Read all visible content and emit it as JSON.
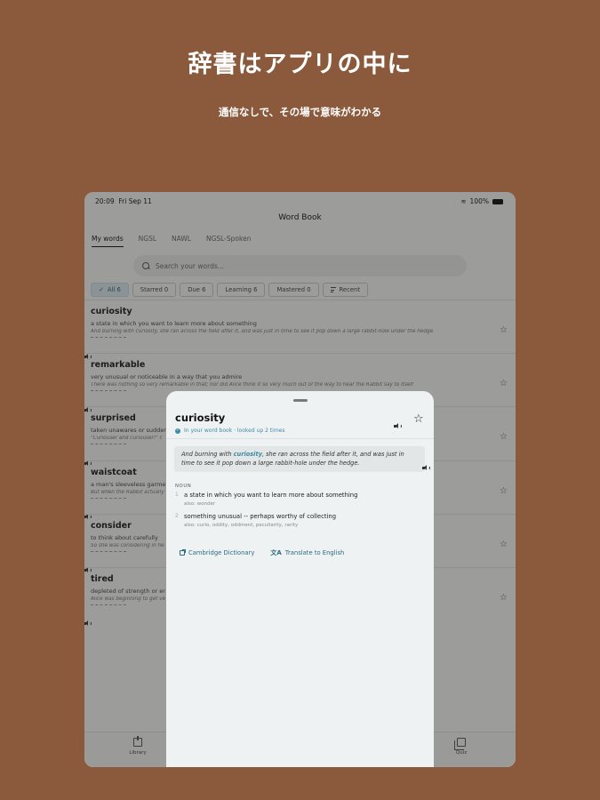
{
  "hero": {
    "title": "辞書はアプリの中に",
    "subtitle": "通信なしで、その場で意味がわかる"
  },
  "status_bar": {
    "time": "20:09",
    "date": "Fri Sep 11",
    "battery": "100%"
  },
  "nav": {
    "title": "Word Book"
  },
  "tabs": [
    "My words",
    "NGSL",
    "NAWL",
    "NGSL-Spoken"
  ],
  "search": {
    "placeholder": "Search your words..."
  },
  "filters": [
    "All 6",
    "Starred 0",
    "Due 6",
    "Learning 6",
    "Mastered 0",
    "Recent"
  ],
  "words": [
    {
      "word": "curiosity",
      "def": "a state in which you want to learn more about something",
      "example": "And burning with curiosity, she ran across the field after it, and was just in time to see it pop down a large rabbit-hole under the hedge."
    },
    {
      "word": "remarkable",
      "def": "very unusual or noticeable in a way that you admire",
      "example": "There was nothing so very remarkable in that; nor did Alice think it so very much out of the way to hear the Rabbit say to itself"
    },
    {
      "word": "surprised",
      "def": "taken unawares or sudden",
      "example": "\"Curiouser and curiouser!\" c"
    },
    {
      "word": "waistcoat",
      "def": "a man's sleeveless garme",
      "example": "But when the Rabbit actually"
    },
    {
      "word": "consider",
      "def": "to think about carefully",
      "example": "So she was considering in he"
    },
    {
      "word": "tired",
      "def": "depleted of strength or er",
      "example": "Alice was beginning to get ve"
    }
  ],
  "tabbar": {
    "library": "Library",
    "quiz": "Quiz"
  },
  "sheet": {
    "word": "curiosity",
    "status": "In your word book · looked up 2 times",
    "example_before": "And burning with ",
    "example_highlight": "curiosity",
    "example_after": ", she ran across the field after it, and was just in time to see it pop down a large rabbit-hole under the hedge.",
    "pos": "NOUN",
    "senses": [
      {
        "num": "1",
        "def": "a state in which you want to learn more about something",
        "also": "also: wonder"
      },
      {
        "num": "2",
        "def": "something unusual -- perhaps worthy of collecting",
        "also": "also: curio, oddity, oddment, peculiarity, rarity"
      }
    ],
    "links": {
      "dictionary": "Cambridge Dictionary",
      "translate": "Translate to English"
    }
  },
  "colors": {
    "background": "#8b5a3c",
    "accent": "#3f8ba3",
    "link": "#2b6b80"
  }
}
